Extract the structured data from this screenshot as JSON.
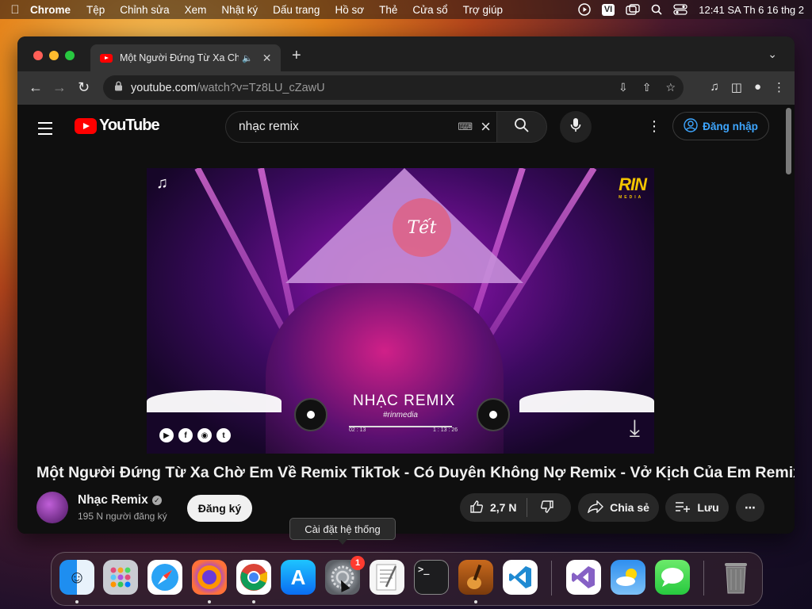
{
  "menubar": {
    "app": "Chrome",
    "items": [
      "Tệp",
      "Chỉnh sửa",
      "Xem",
      "Nhật ký",
      "Dấu trang",
      "Hồ sơ",
      "Thẻ",
      "Cửa sổ",
      "Trợ giúp"
    ],
    "input_source": "VI",
    "clock": "12:41 SA Th 6 16 thg 2"
  },
  "browser": {
    "tab_title": "Một Người Đứng Từ Xa Chờ Em Về Remix TikTok",
    "url_host": "youtube.com",
    "url_path": "/watch?v=Tz8LU_cZawU"
  },
  "youtube": {
    "logo_text": "YouTube",
    "search_query": "nhạc remix",
    "sign_in": "Đăng nhập",
    "video": {
      "overlay_title": "NHẠC REMIX",
      "overlay_subtitle": "#rinmedia",
      "time_current": "02 : 13",
      "time_total": "1 : 13 : 26",
      "stamp_text": "Tết",
      "brand_right": "RIN",
      "brand_right_sub": "MEDIA"
    },
    "title": "Một Người Đứng Từ Xa Chờ Em Về Remix TikTok - Có Duyên Không Nợ Remix - Vở Kịch Của Em Remix",
    "channel": {
      "name": "Nhạc Remix",
      "subscribers": "195 N người đăng ký",
      "subscribe_label": "Đăng ký"
    },
    "actions": {
      "likes": "2,7 N",
      "share": "Chia sẻ",
      "save": "Lưu"
    }
  },
  "tooltip": "Cài đặt hệ thống",
  "dock": {
    "badge_count": "1",
    "apps": [
      "Finder",
      "Launchpad",
      "Safari",
      "Firefox",
      "Chrome",
      "App Store",
      "System Settings",
      "TextEdit",
      "Terminal",
      "GarageBand",
      "Visual Studio Code",
      "Visual Studio",
      "Weather",
      "Messages",
      "Trash"
    ]
  }
}
